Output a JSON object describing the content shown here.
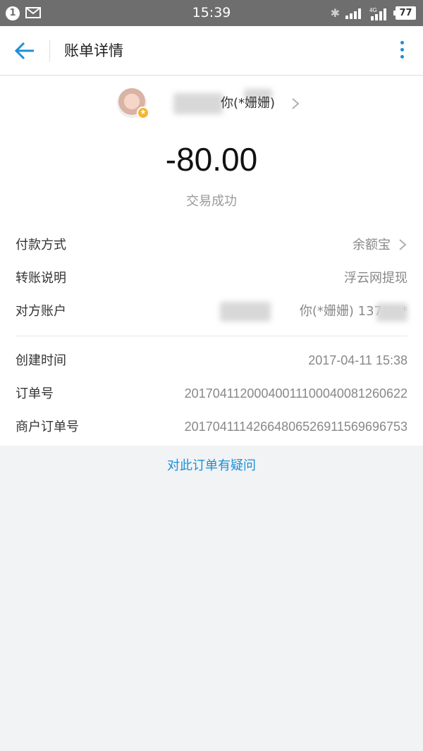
{
  "status_bar": {
    "notification_count": "1",
    "time": "15:39",
    "network": "4G",
    "battery": "77"
  },
  "header": {
    "title": "账单详情"
  },
  "counterparty": {
    "name": "你(*姗姗)"
  },
  "transaction": {
    "amount": "-80.00",
    "status": "交易成功"
  },
  "details": [
    {
      "label": "付款方式",
      "value": "余额宝"
    },
    {
      "label": "转账说明",
      "value": "浮云网提现"
    },
    {
      "label": "对方账户",
      "value": "你(*姗姗) 137****"
    }
  ],
  "order_info": [
    {
      "label": "创建时间",
      "value": "2017-04-11 15:38"
    },
    {
      "label": "订单号",
      "value": "20170411200040011100040081260622"
    },
    {
      "label": "商户订单号",
      "value": "20170411142664806526911569696753"
    }
  ],
  "help": {
    "question_link": "对此订单有疑问"
  },
  "colors": {
    "accent": "#1a8fd8",
    "status_bar": "#6e6e6e",
    "page_bg": "#f2f3f5"
  }
}
